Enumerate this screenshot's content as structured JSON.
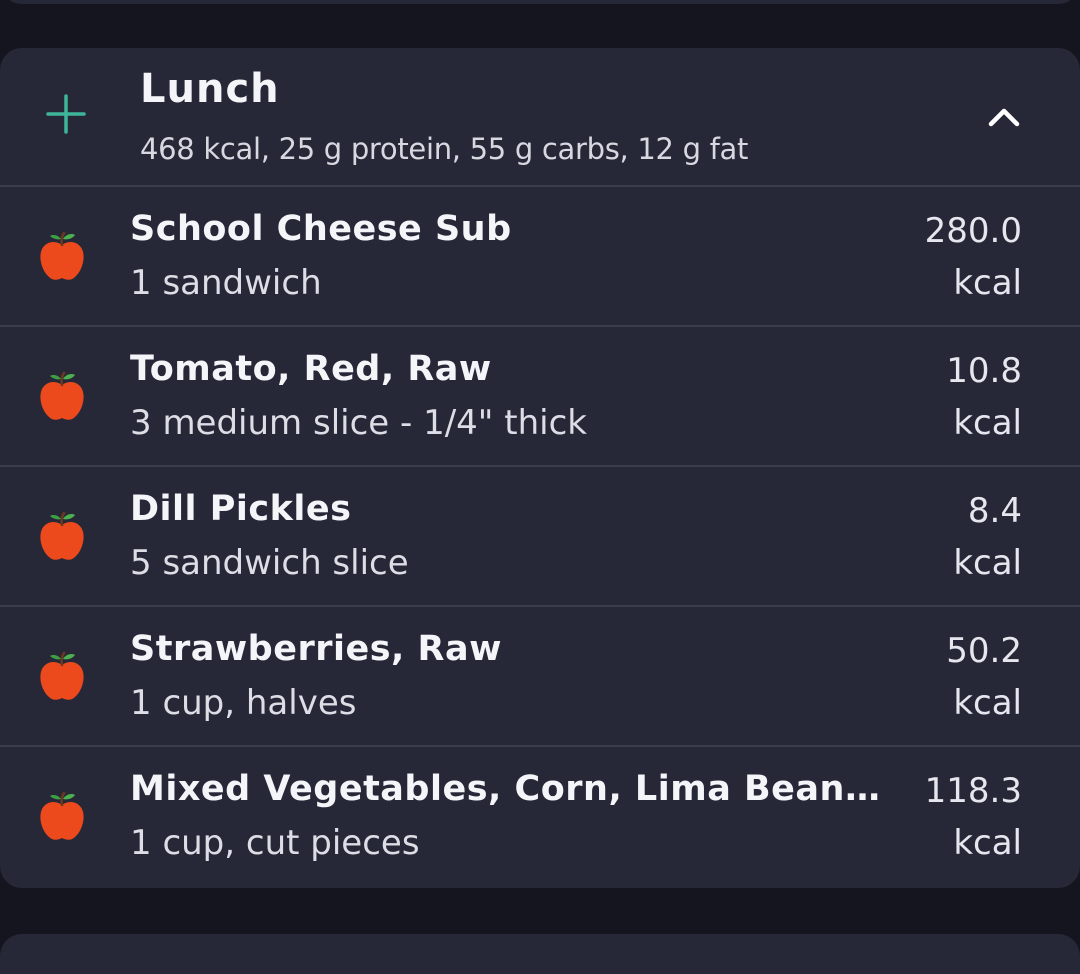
{
  "meal": {
    "title": "Lunch",
    "summary": "468 kcal, 25 g protein, 55 g carbs, 12 g fat",
    "add_icon": "plus-icon",
    "collapse_icon": "chevron-up-icon",
    "accent_color": "#3fb59a"
  },
  "foods": [
    {
      "name": "School Cheese Sub",
      "serving": "1 sandwich",
      "calories": "280.0",
      "unit": "kcal",
      "icon": "apple-icon"
    },
    {
      "name": "Tomato, Red, Raw",
      "serving": "3 medium slice - 1/4\" thick",
      "calories": "10.8",
      "unit": "kcal",
      "icon": "apple-icon"
    },
    {
      "name": "Dill Pickles",
      "serving": "5 sandwich slice",
      "calories": "8.4",
      "unit": "kcal",
      "icon": "apple-icon"
    },
    {
      "name": "Strawberries, Raw",
      "serving": "1 cup, halves",
      "calories": "50.2",
      "unit": "kcal",
      "icon": "apple-icon"
    },
    {
      "name": "Mixed Vegetables, Corn, Lima Beans, …",
      "serving": "1 cup, cut pieces",
      "calories": "118.3",
      "unit": "kcal",
      "icon": "apple-icon"
    }
  ]
}
